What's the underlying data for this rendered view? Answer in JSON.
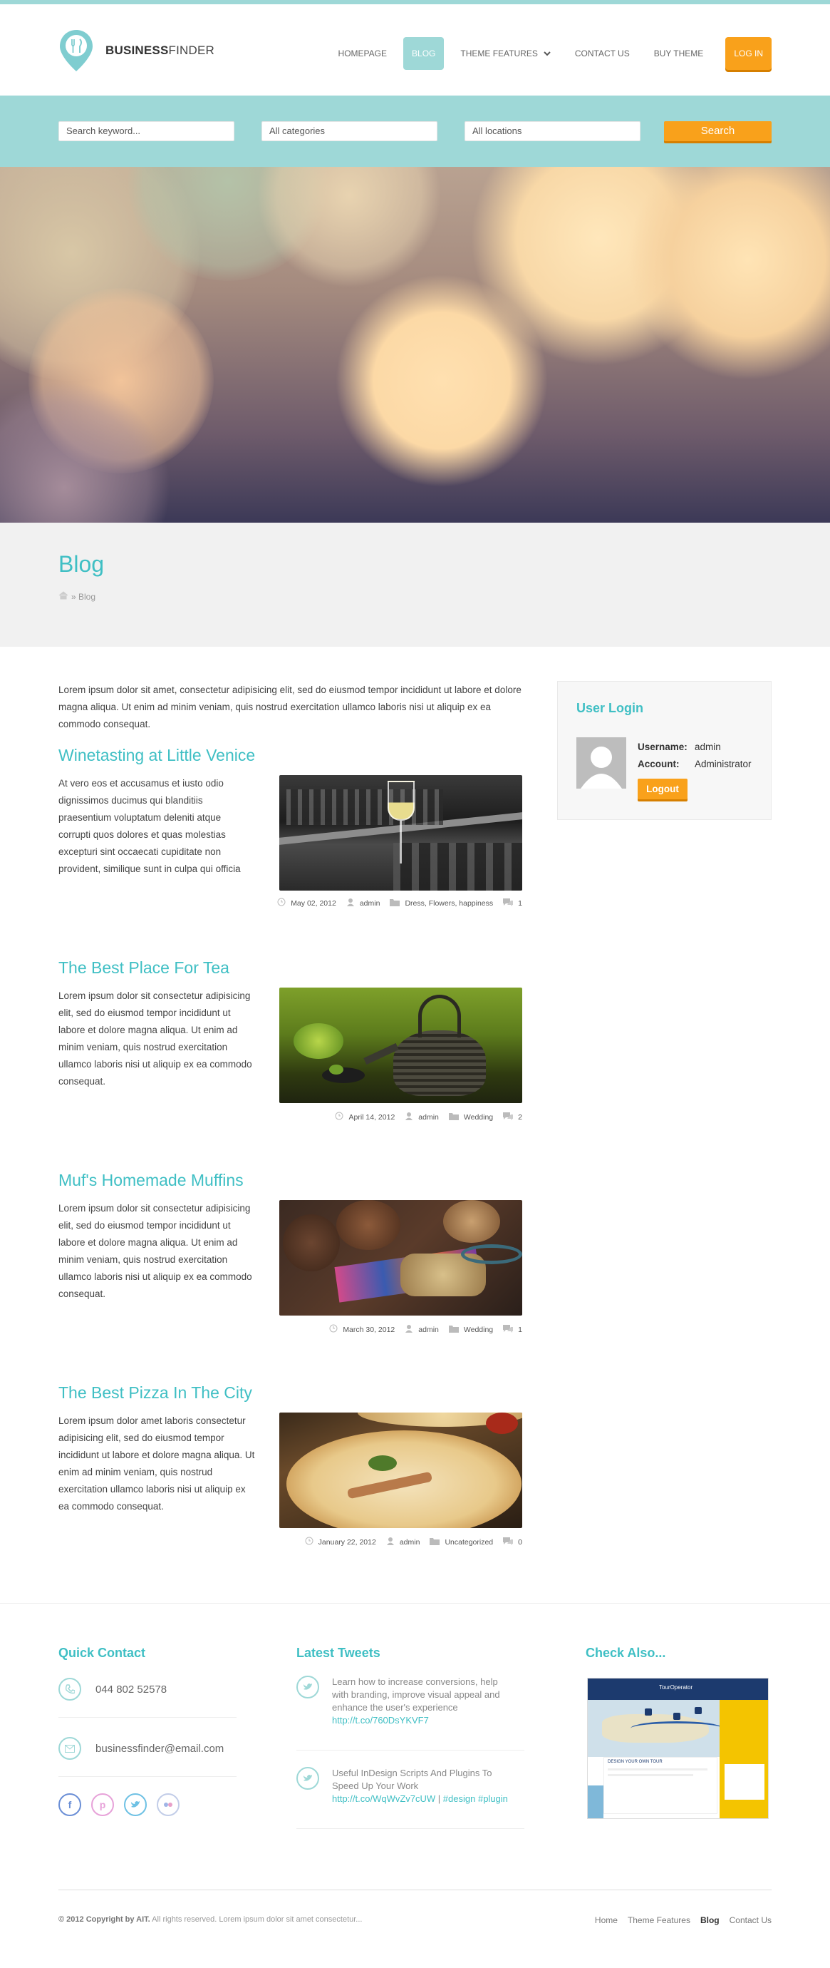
{
  "brand": {
    "bold": "BUSINESS",
    "light": "FINDER"
  },
  "nav": {
    "items": [
      {
        "label": "HOMEPAGE"
      },
      {
        "label": "BLOG"
      },
      {
        "label": "THEME FEATURES"
      },
      {
        "label": "CONTACT US"
      },
      {
        "label": "BUY THEME"
      }
    ],
    "login": "LOG IN"
  },
  "search": {
    "keyword": "Search keyword...",
    "category": "All categories",
    "location": "All locations",
    "button": "Search"
  },
  "page": {
    "title": "Blog",
    "breadcrumb": "» Blog"
  },
  "intro": "Lorem ipsum dolor sit amet, consectetur adipisicing elit, sed do eiusmod tempor incididunt ut labore et dolore magna aliqua. Ut enim ad minim veniam, quis nostrud exercitation ullamco laboris nisi ut aliquip ex ea commodo consequat.",
  "posts": [
    {
      "title": "Winetasting at Little Venice",
      "text": "At vero eos et accusamus et iusto odio dignissimos ducimus qui blanditiis praesentium voluptatum deleniti atque corrupti quos dolores et quas molestias excepturi sint occaecati cupiditate non provident, similique sunt in culpa qui officia",
      "date": "May 02, 2012",
      "author": "admin",
      "categories": "Dress, Flowers, happiness",
      "comments": "1"
    },
    {
      "title": "The Best Place For Tea",
      "text": "Lorem ipsum dolor sit consectetur adipisicing elit, sed do eiusmod tempor incididunt ut labore et dolore magna aliqua. Ut enim ad minim veniam, quis nostrud exercitation ullamco laboris nisi ut aliquip ex ea commodo consequat.",
      "date": "April 14, 2012",
      "author": "admin",
      "categories": "Wedding",
      "comments": "2"
    },
    {
      "title": "Muf's Homemade Muffins",
      "text": "Lorem ipsum dolor sit consectetur adipisicing elit, sed do eiusmod tempor incididunt ut labore et dolore magna aliqua. Ut enim ad minim veniam, quis nostrud exercitation ullamco laboris nisi ut aliquip ex ea commodo consequat.",
      "date": "March 30, 2012",
      "author": "admin",
      "categories": "Wedding",
      "comments": "1"
    },
    {
      "title": "The Best Pizza In The City",
      "text": "Lorem ipsum dolor amet laboris consectetur adipisicing elit, sed do eiusmod tempor incididunt ut labore et dolore magna aliqua. Ut enim ad minim veniam, quis nostrud exercitation ullamco laboris nisi ut aliquip ex ea commodo consequat.",
      "date": "January 22, 2012",
      "author": "admin",
      "categories": "Uncategorized",
      "comments": "0"
    }
  ],
  "sidebar": {
    "title": "User Login",
    "username_label": "Username:",
    "username": "admin",
    "account_label": "Account:",
    "account": "Administrator",
    "logout": "Logout"
  },
  "footer": {
    "quick_contact_title": "Quick Contact",
    "phone": "044 802 52578",
    "email": "businessfinder@email.com",
    "tweets_title": "Latest Tweets",
    "tweet1": {
      "text": "Learn how to increase conversions, help with branding, improve visual appeal and enhance the user's experience",
      "link": "http://t.co/760DsYKVF7"
    },
    "tweet2": {
      "text": "Useful InDesign Scripts And Plugins To Speed Up Your Work",
      "link": "http://t.co/WqWvZv7cUW",
      "sep": " | ",
      "tag1": "#design",
      "tag2": "#plugin"
    },
    "check_title": "Check Also...",
    "check_shot_title": "TourOperator",
    "check_shot_caption": "DESIGN YOUR OWN TOUR",
    "copyright_bold": "© 2012 Copyright by AIT.",
    "copyright_rest": " All rights reserved. Lorem ipsum dolor sit amet consectetur...",
    "links": [
      "Home",
      "Theme Features",
      "Blog",
      "Contact Us"
    ]
  },
  "colors": {
    "accent": "#3fbfc4",
    "bar": "#9ed8d7",
    "orange": "#f9a11b"
  }
}
